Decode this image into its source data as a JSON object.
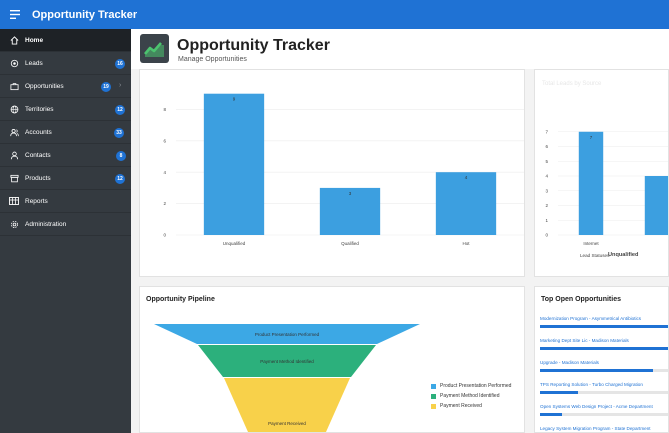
{
  "app": {
    "title": "Opportunity Tracker"
  },
  "nav": [
    {
      "label": "Home",
      "icon": "home-icon",
      "active": true
    },
    {
      "label": "Leads",
      "icon": "target-icon",
      "badge": "16"
    },
    {
      "label": "Opportunities",
      "icon": "briefcase-icon",
      "badge": "19",
      "chevron": true
    },
    {
      "label": "Territories",
      "icon": "globe-icon",
      "badge": "12"
    },
    {
      "label": "Accounts",
      "icon": "users-icon",
      "badge": "33"
    },
    {
      "label": "Contacts",
      "icon": "user-icon",
      "badge": "8"
    },
    {
      "label": "Products",
      "icon": "box-icon",
      "badge": "12"
    },
    {
      "label": "Reports",
      "icon": "table-icon"
    },
    {
      "label": "Administration",
      "icon": "gear-icon"
    }
  ],
  "hero": {
    "title": "Opportunity Tracker",
    "subtitle": "Manage Opportunities"
  },
  "cards": {
    "total_leads": {
      "title": "Total Leads by Source",
      "legend_prefix": "Lead Statuses",
      "legend_item": "Unqualified"
    },
    "pipeline": {
      "title": "Opportunity Pipeline"
    },
    "top_open": {
      "title": "Top Open Opportunities"
    }
  },
  "top_opportunities": [
    {
      "label": "Modernization Program - Asymmetrical Antibiotics",
      "progress": 1.0
    },
    {
      "label": "Marketing Dept Site Lic - Madison Materials",
      "progress": 1.0
    },
    {
      "label": "Upgrade - Madison Materials",
      "progress": 0.87
    },
    {
      "label": "TPS Reporting Solution - Turbo Charged Migration",
      "progress": 0.29
    },
    {
      "label": "Open Systems Web Design Project - Acme Department",
      "progress": 0.17
    },
    {
      "label": "Legacy System Migration Program - State Department",
      "progress": 0.12
    }
  ],
  "colors": {
    "accent": "#1f72d4",
    "bar": "#3c9fe0",
    "funnel": [
      "#3ca8e5",
      "#2cb07c",
      "#f8d14a"
    ]
  },
  "chart_data": [
    {
      "type": "bar",
      "categories": [
        "Unqualified",
        "Qualified",
        "Hot"
      ],
      "values": [
        9,
        3,
        4
      ],
      "ylim": [
        0,
        10
      ],
      "yticks": [
        0,
        2,
        4,
        6,
        8
      ],
      "grid": true
    },
    {
      "type": "bar",
      "title": "Total Leads by Source",
      "categories": [
        "Internet"
      ],
      "values": [
        7
      ],
      "partial_next_value": 4,
      "ylim": [
        0,
        8
      ],
      "yticks": [
        0,
        1,
        2,
        3,
        4,
        5,
        6,
        7
      ],
      "grid": true,
      "legend": {
        "placement": "bottom",
        "title": "Lead Statuses",
        "items": [
          "Unqualified"
        ]
      }
    },
    {
      "type": "funnel",
      "title": "Opportunity Pipeline",
      "stages": [
        "Product Presentation Performed",
        "Payment Method Identified",
        "Payment Received"
      ],
      "legend": {
        "placement": "right",
        "items": [
          "Product Presentation Performed",
          "Payment Method Identified",
          "Payment Received"
        ]
      }
    }
  ]
}
